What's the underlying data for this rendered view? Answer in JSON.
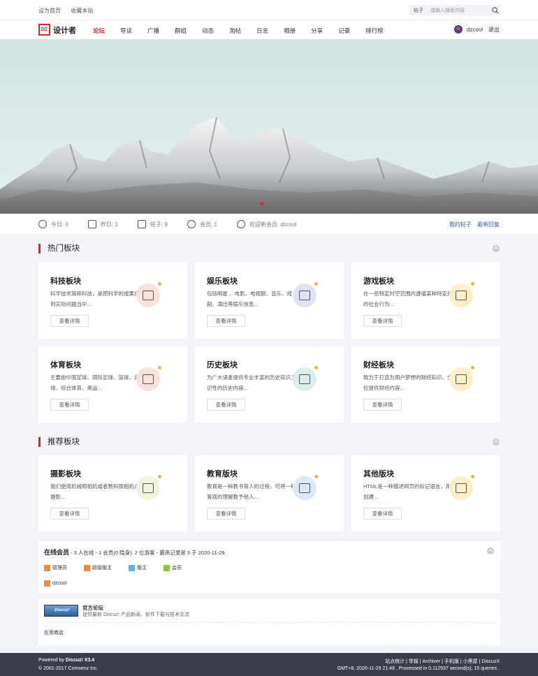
{
  "topbar": {
    "set_home": "设为首页",
    "bookmark": "收藏本站",
    "search_category": "帖子",
    "search_placeholder": "请输入搜索内容"
  },
  "logo": {
    "mark": "DZ",
    "text": "设计者"
  },
  "nav": [
    "论坛",
    "导读",
    "广播",
    "群组",
    "动态",
    "淘帖",
    "日志",
    "相册",
    "分享",
    "记录",
    "排行榜"
  ],
  "user": {
    "name": "dzcool",
    "logout": "退出"
  },
  "stats": {
    "today": "今日: 0",
    "yesterday": "昨日: 1",
    "posts": "帖子: 9",
    "members": "会员: 1",
    "welcome": "欢迎新会员: dzcool",
    "my_posts": "我的帖子",
    "latest_reply": "最新回复"
  },
  "hot": {
    "title": "热门板块",
    "cards": [
      {
        "title": "科技板块",
        "desc": "科学技术简称科技，是把科学的成果应用到实际问题当中...",
        "button": "查看详情",
        "icon": "list-icon",
        "color": "#fbe1da"
      },
      {
        "title": "娱乐板块",
        "desc": "包括明星 、电影、电视剧、音乐、戏剧、演出等娱乐信息...",
        "button": "查看详情",
        "icon": "briefcase-icon",
        "color": "#dfe3f3"
      },
      {
        "title": "游戏板块",
        "desc": "在一些特定时空范围内遵循某种特定规则的社会行为...",
        "button": "查看详情",
        "icon": "info-board-icon",
        "color": "#fbefc8"
      },
      {
        "title": "体育板块",
        "desc": "主要由中国足球、国际足球、篮球、乒乓球、综合体育、奥运...",
        "button": "查看详情",
        "icon": "notebook-icon",
        "color": "#fbe1da"
      },
      {
        "title": "历史板块",
        "desc": "为广大读者提供专业丰富的历史知识,知识性的历史内容...",
        "button": "查看详情",
        "icon": "house-icon",
        "color": "#d9efee"
      },
      {
        "title": "财经板块",
        "desc": "致力于打造为用户梦想的财经知识、全方位提供财经内容...",
        "button": "查看详情",
        "icon": "edit-icon",
        "color": "#fbefc8"
      }
    ]
  },
  "recommend": {
    "title": "推荐板块",
    "cards": [
      {
        "title": "摄影板块",
        "desc": "我们使用机械照相机或者数码照相机进行摄影...",
        "button": "查看详情",
        "icon": "camera-icon",
        "color": "#eef5d8"
      },
      {
        "title": "教育版块",
        "desc": "教育是一种教书育人的过程，可将一种最客观的理解教予他人...",
        "button": "查看详情",
        "icon": "document-icon",
        "color": "#dbe8f5"
      },
      {
        "title": "其他版块",
        "desc": "HTML是一种描述网页的标记语言，用于创建...",
        "button": "查看详情",
        "icon": "info-board-icon",
        "color": "#fbefc8"
      }
    ]
  },
  "online": {
    "title": "在线会员",
    "summary": " - 3 人在线 - 1 会员(0 隐身), 2 位游客 - 最高记录是 3 于 2020-11-29.",
    "legend": [
      {
        "label": "管理员",
        "color": "#f08a3c"
      },
      {
        "label": "超级版主",
        "color": "#f08a3c"
      },
      {
        "label": "版主",
        "color": "#5ab4e0"
      },
      {
        "label": "会员",
        "color": "#8cc63f"
      }
    ],
    "member": "dzcool",
    "member_color": "#f08a3c"
  },
  "friend": {
    "badge": "Discuz!",
    "name": "官方论坛",
    "desc": "提供最新 Discuz! 产品新闻、软件下载与技术交流",
    "app": "应用商店"
  },
  "footer": {
    "powered_prefix": "Powered by ",
    "powered": "Discuz! X3.4",
    "copyright": "© 2001-2017 Comsenz Inc.",
    "links": "站点统计 | 举报 | Archiver | 手机版 | 小黑屋 | DiscuzX",
    "time": "GMT+8, 2020-11-29 21:49 , Processed in 0.112537 second(s), 15 queries ."
  }
}
